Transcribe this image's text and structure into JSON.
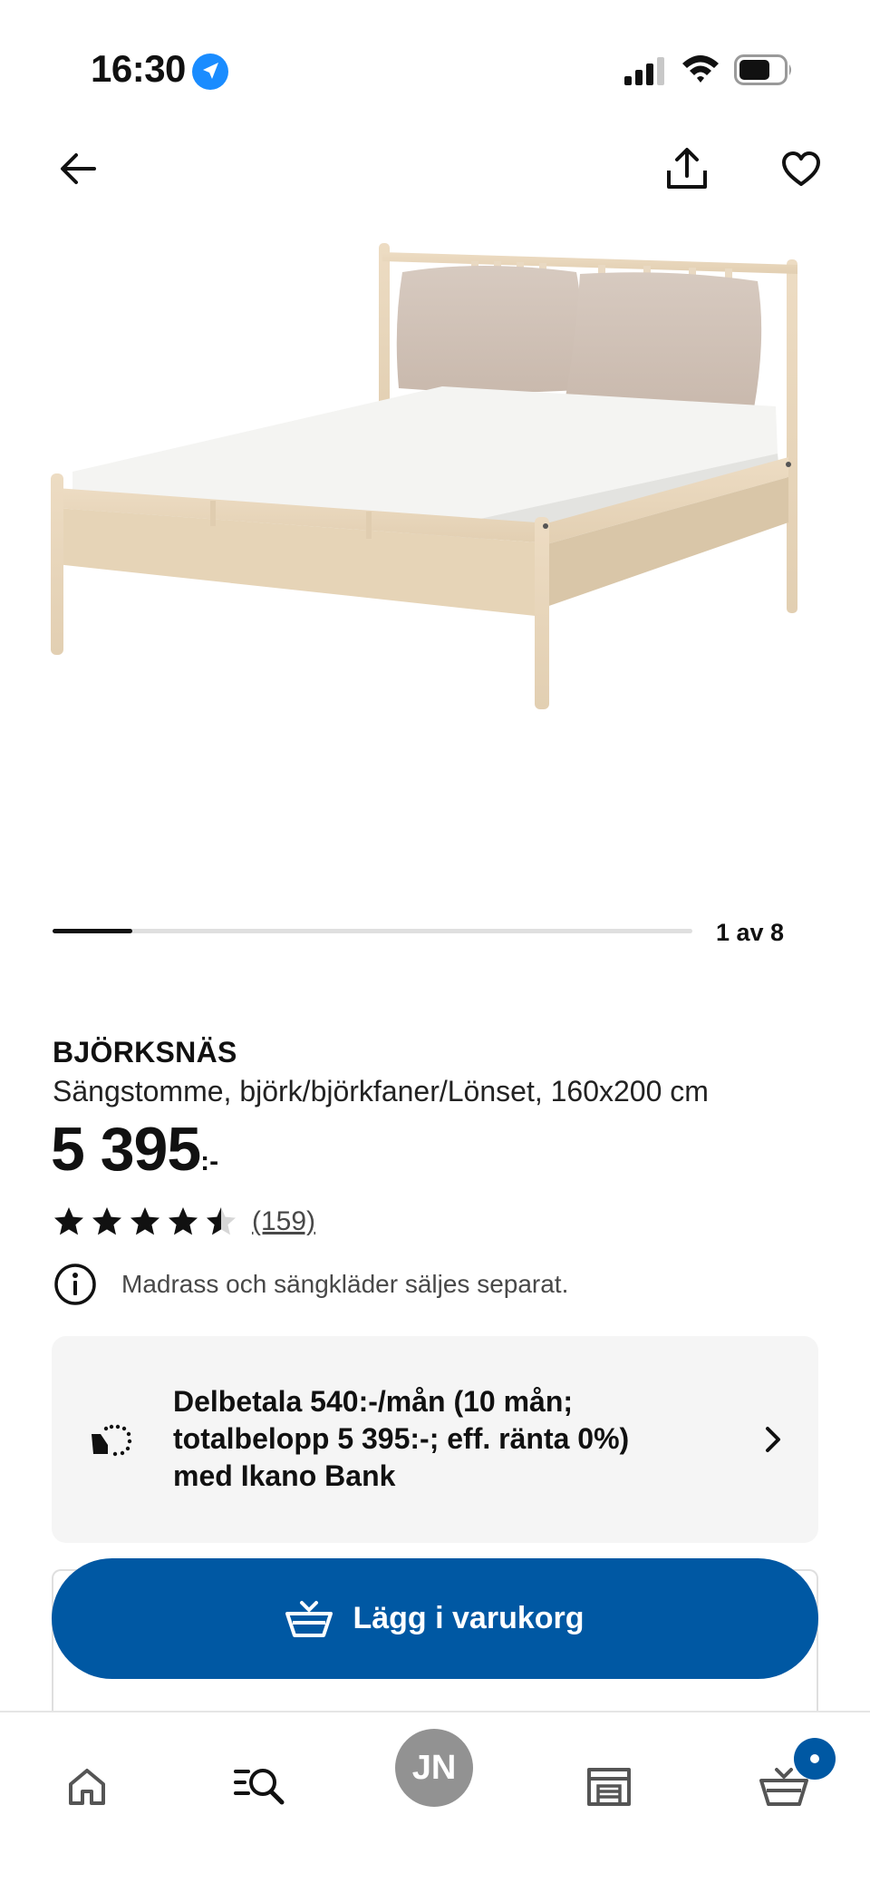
{
  "status_bar": {
    "time": "16:30"
  },
  "carousel": {
    "counter": "1 av 8",
    "progress": 0.125
  },
  "product": {
    "name": "BJÖRKSNÄS",
    "description": "Sängstomme, björk/björkfaner/Lönset, 160x200 cm",
    "price": "5 395",
    "price_suffix": ":-",
    "rating": 4.5,
    "review_count": "(159)",
    "notice": "Madrass och sängkläder säljes separat."
  },
  "financing": {
    "text": "Delbetala 540:-/mån (10 mån; totalbelopp 5 395:-; eff. ränta 0%) med Ikano Bank"
  },
  "cart_button": {
    "label": "Lägg i varukorg"
  },
  "bottom_nav": {
    "avatar_initials": "JN"
  },
  "colors": {
    "accent": "#0058a3",
    "finance_bg": "#f5f5f5",
    "avatar_bg": "#929292"
  },
  "icons": [
    "location-arrow-icon",
    "signal-icon",
    "wifi-icon",
    "battery-icon",
    "back-arrow-icon",
    "share-icon",
    "heart-icon",
    "star-icon",
    "info-icon",
    "installment-icon",
    "chevron-right-icon",
    "cart-icon",
    "home-icon",
    "search-icon",
    "store-icon"
  ]
}
